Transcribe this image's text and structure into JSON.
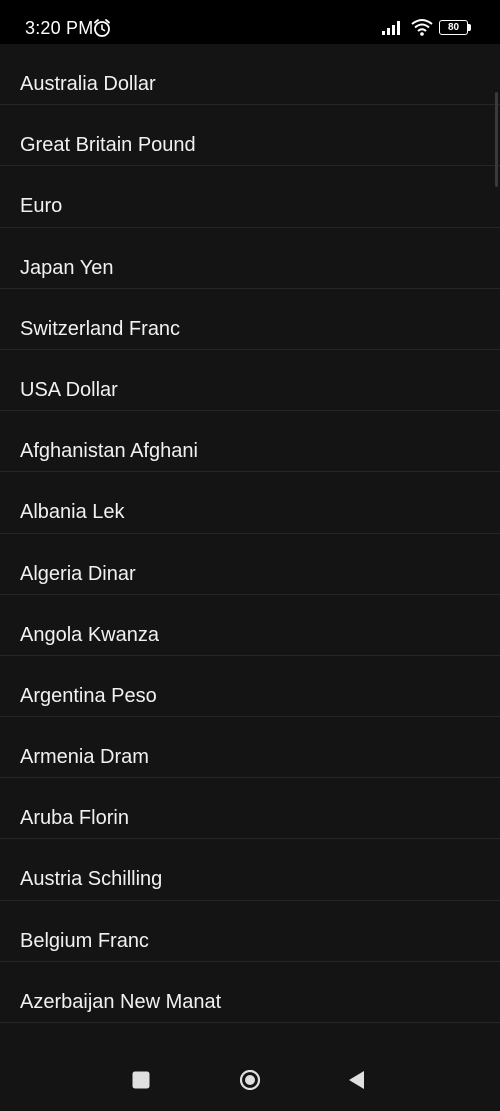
{
  "status_bar": {
    "time": "3:20 PM",
    "battery_level": "80",
    "icons": [
      "alarm-icon",
      "signal-icon",
      "wifi-icon",
      "battery-icon"
    ]
  },
  "currency_list": {
    "items": [
      {
        "label": "Australia Dollar"
      },
      {
        "label": "Great Britain Pound"
      },
      {
        "label": "Euro"
      },
      {
        "label": "Japan Yen"
      },
      {
        "label": "Switzerland Franc"
      },
      {
        "label": "USA Dollar"
      },
      {
        "label": "Afghanistan Afghani"
      },
      {
        "label": "Albania Lek"
      },
      {
        "label": "Algeria Dinar"
      },
      {
        "label": "Angola Kwanza"
      },
      {
        "label": "Argentina Peso"
      },
      {
        "label": "Armenia Dram"
      },
      {
        "label": "Aruba Florin"
      },
      {
        "label": "Austria Schilling"
      },
      {
        "label": "Belgium Franc"
      },
      {
        "label": "Azerbaijan New Manat"
      }
    ]
  },
  "nav_bar": {
    "icons": [
      "recents-icon",
      "home-icon",
      "back-icon"
    ]
  },
  "colors": {
    "background": "#141414",
    "text": "#f1f1f1",
    "divider": "#262626"
  }
}
